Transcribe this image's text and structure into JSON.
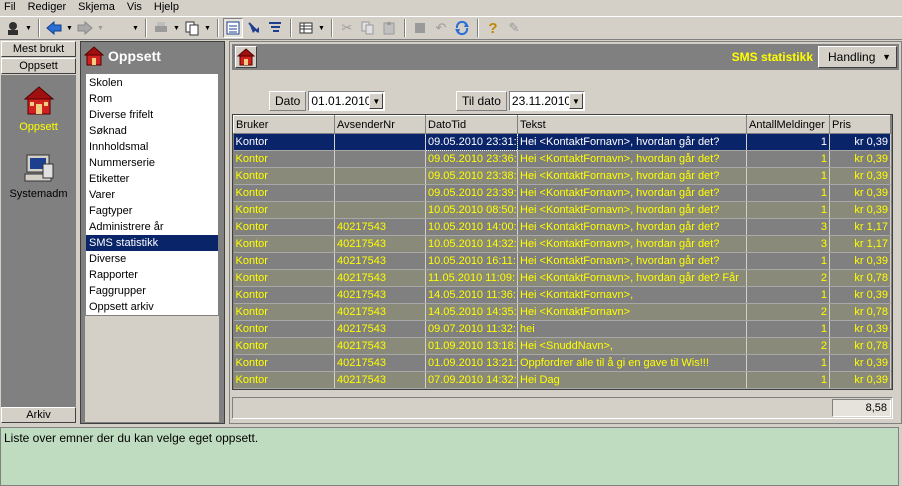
{
  "menu": [
    "Fil",
    "Rediger",
    "Skjema",
    "Vis",
    "Hjelp"
  ],
  "toolbar": {
    "icons": [
      "user-menu-icon",
      "back-arrow-icon",
      "forward-arrow-icon",
      "print-icon",
      "copy-doc-icon",
      "list-view-icon",
      "import-icon",
      "filter-icon",
      "table-icon",
      "cut-icon",
      "copy-icon",
      "paste-icon",
      "stop-icon",
      "undo-icon",
      "refresh-icon",
      "help-icon",
      "edit-icon"
    ]
  },
  "nav": {
    "top_buttons": [
      "Mest brukt",
      "Oppsett"
    ],
    "items": [
      {
        "label": "Oppsett",
        "icon": "house-icon",
        "label_color": "#ffff00"
      },
      {
        "label": "Systemadm",
        "icon": "computer-icon",
        "label_color": "#000000"
      }
    ],
    "bottom_button": "Arkiv"
  },
  "list_panel": {
    "title": "Oppsett",
    "icon": "house-icon",
    "items": [
      "Skolen",
      "Rom",
      "Diverse frifelt",
      "Søknad",
      "Innholdsmal",
      "Nummerserie",
      "Etiketter",
      "Varer",
      "Fagtyper",
      "Administrere år",
      "SMS statistikk",
      "Diverse",
      "Rapporter",
      "Faggrupper",
      "Oppsett arkiv"
    ],
    "selected_index": 10
  },
  "detail": {
    "title": "SMS statistikk",
    "action_button": "Handling",
    "filters": {
      "date_label": "Dato",
      "date_value": "01.01.2010",
      "to_date_label": "Til dato",
      "to_date_value": "23.11.2010"
    },
    "table": {
      "columns": [
        "Bruker",
        "AvsenderNr",
        "DatoTid",
        "Tekst",
        "AntallMeldinger",
        "Pris"
      ],
      "rows": [
        [
          "Kontor",
          "",
          "09.05.2010 23:31:",
          "Hei <KontaktFornavn>, hvordan går det?",
          "1",
          "kr 0,39"
        ],
        [
          "Kontor",
          "",
          "09.05.2010 23:36:",
          "Hei <KontaktFornavn>, hvordan går det?",
          "1",
          "kr 0,39"
        ],
        [
          "Kontor",
          "",
          "09.05.2010 23:38:",
          "Hei <KontaktFornavn>, hvordan går det?",
          "1",
          "kr 0,39"
        ],
        [
          "Kontor",
          "",
          "09.05.2010 23:39:",
          "Hei <KontaktFornavn>, hvordan går det?",
          "1",
          "kr 0,39"
        ],
        [
          "Kontor",
          "",
          "10.05.2010 08:50:",
          "Hei <KontaktFornavn>, hvordan går det?",
          "1",
          "kr 0,39"
        ],
        [
          "Kontor",
          "40217543",
          "10.05.2010 14:00:",
          "Hei <KontaktFornavn>, hvordan går det?",
          "3",
          "kr 1,17"
        ],
        [
          "Kontor",
          "40217543",
          "10.05.2010 14:32:",
          "Hei <KontaktFornavn>, hvordan går det?",
          "3",
          "kr 1,17"
        ],
        [
          "Kontor",
          "40217543",
          "10.05.2010 16:11:",
          "Hei <KontaktFornavn>, hvordan går det?",
          "1",
          "kr 0,39"
        ],
        [
          "Kontor",
          "40217543",
          "11.05.2010 11:09:",
          "Hei <KontaktFornavn>, hvordan går det? Får",
          "2",
          "kr 0,78"
        ],
        [
          "Kontor",
          "40217543",
          "14.05.2010 11:36:",
          "Hei <KontaktFornavn>,",
          "1",
          "kr 0,39"
        ],
        [
          "Kontor",
          "40217543",
          "14.05.2010 14:35:",
          "Hei <KontaktFornavn>",
          "2",
          "kr 0,78"
        ],
        [
          "Kontor",
          "40217543",
          "09.07.2010 11:32:",
          "hei",
          "1",
          "kr 0,39"
        ],
        [
          "Kontor",
          "40217543",
          "01.09.2010 13:18:",
          "Hei <SnuddNavn>,",
          "2",
          "kr 0,78"
        ],
        [
          "Kontor",
          "40217543",
          "01.09.2010 13:21:",
          "Oppfordrer alle til å gi en gave til Wis!!!",
          "1",
          "kr 0,39"
        ],
        [
          "Kontor",
          "40217543",
          "07.09.2010 14:32:",
          "Hei Dag",
          "1",
          "kr 0,39"
        ]
      ],
      "selected_row": 0
    },
    "total": "8,58"
  },
  "status_text": "Liste over emner der du kan velge eget oppsett.",
  "colors": {
    "accent_yellow": "#ffff00",
    "selection": "#0a246a",
    "status_bg": "#c0dcc0",
    "pane_gray": "#808080"
  }
}
